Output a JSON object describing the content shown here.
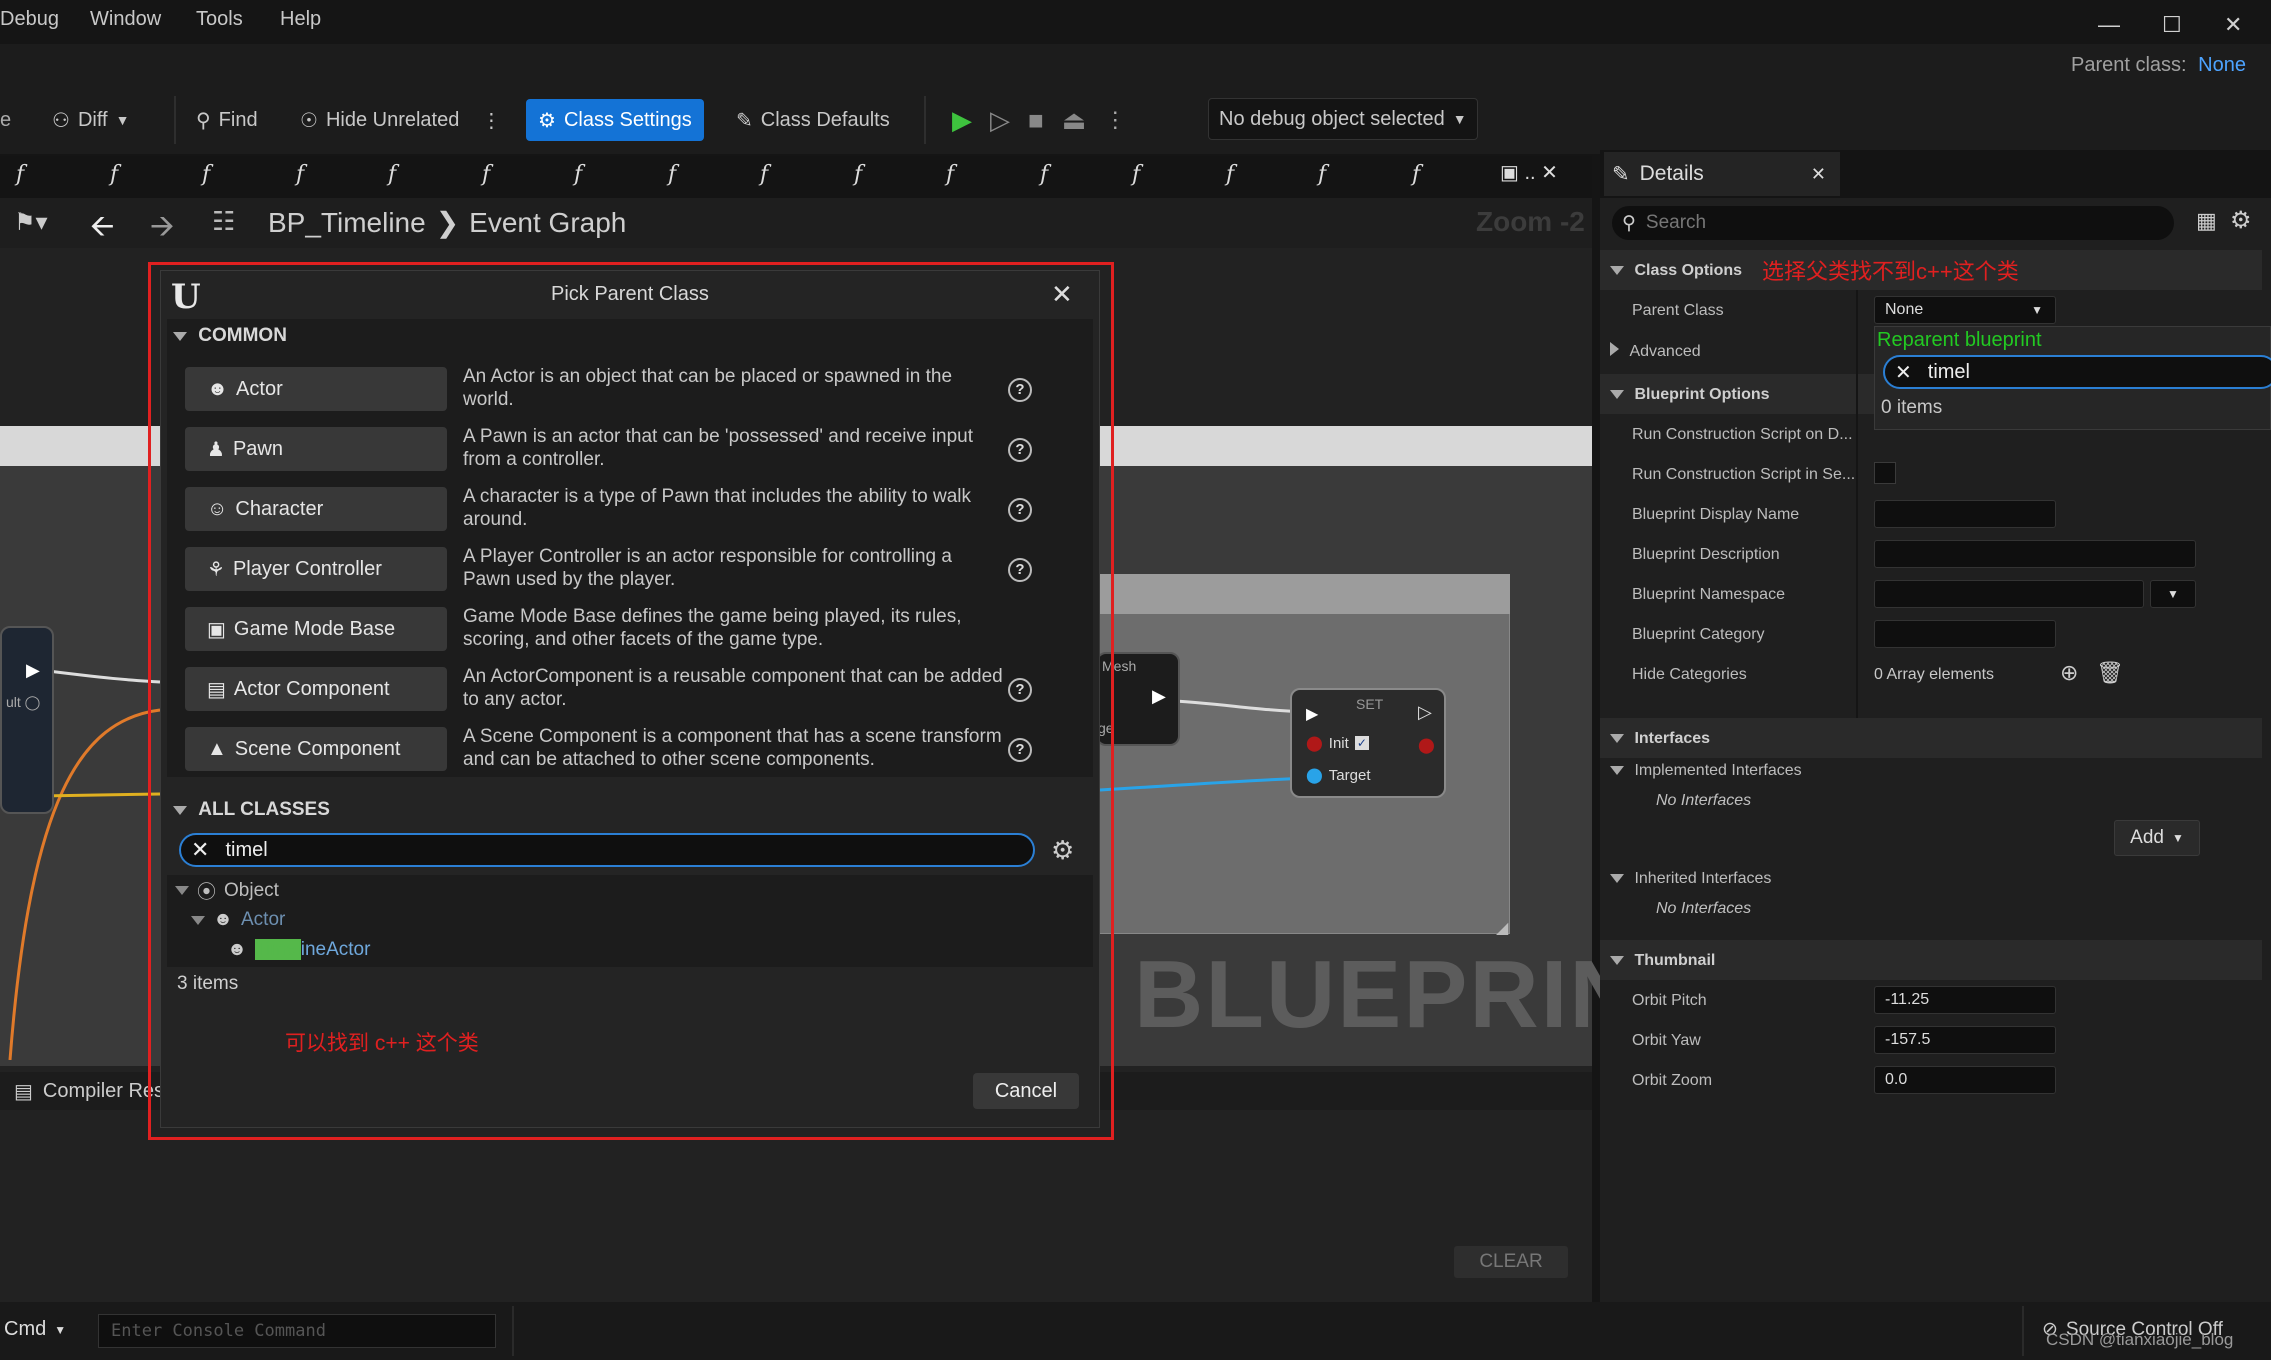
{
  "menu": [
    "Debug",
    "Window",
    "Tools",
    "Help"
  ],
  "parent_class_label": "Parent class:",
  "parent_class_value": "None",
  "toolbar": {
    "diff": "Diff",
    "find": "Find",
    "hide_unrelated": "Hide Unrelated",
    "class_settings": "Class Settings",
    "class_defaults": "Class Defaults",
    "debug_object": "No debug object selected"
  },
  "breadcrumb": {
    "blueprint": "BP_Timeline",
    "graph": "Event Graph",
    "zoom": "Zoom -2"
  },
  "graph": {
    "node_mesh_label": "Mesh",
    "node_set_title": "SET",
    "node_init": "Init",
    "node_target": "Target",
    "watermark": "BLUEPRINT",
    "compiler_results": "Compiler Res",
    "clear": "CLEAR"
  },
  "dialog": {
    "title": "Pick Parent Class",
    "common_header": "COMMON",
    "classes": [
      {
        "name": "Actor",
        "icon": "actor-icon",
        "desc": "An Actor is an object that can be placed or spawned in the world."
      },
      {
        "name": "Pawn",
        "icon": "pawn-icon",
        "desc": "A Pawn is an actor that can be 'possessed' and receive input from a controller."
      },
      {
        "name": "Character",
        "icon": "character-icon",
        "desc": "A character is a type of Pawn that includes the ability to walk around."
      },
      {
        "name": "Player Controller",
        "icon": "controller-icon",
        "desc": "A Player Controller is an actor responsible for controlling a Pawn used by the player."
      },
      {
        "name": "Game Mode Base",
        "icon": "gamemode-icon",
        "desc": "Game Mode Base defines the game being played, its rules, scoring, and other facets of the game type."
      },
      {
        "name": "Actor Component",
        "icon": "component-icon",
        "desc": "An ActorComponent is a reusable component that can be added to any actor."
      },
      {
        "name": "Scene Component",
        "icon": "scene-component-icon",
        "desc": "A Scene Component is a component that has a scene transform and can be attached to other scene components."
      }
    ],
    "all_classes_header": "ALL CLASSES",
    "search_value": "timel",
    "tree": {
      "object": "Object",
      "actor": "Actor",
      "match_highlight": "Timel",
      "match_rest": "ineActor"
    },
    "items_count": "3 items",
    "annotation": "可以找到 c++ 这个类",
    "cancel": "Cancel"
  },
  "details": {
    "tab": "Details",
    "search_placeholder": "Search",
    "annotation": "选择父类找不到c++这个类",
    "class_options": "Class Options",
    "parent_class": "Parent Class",
    "parent_class_value": "None",
    "advanced": "Advanced",
    "reparent_label": "Reparent blueprint",
    "reparent_search": "timel",
    "reparent_count": "0 items",
    "blueprint_options": "Blueprint Options",
    "run_construction_1": "Run Construction Script on D...",
    "run_construction_2": "Run Construction Script in Se...",
    "display_name": "Blueprint Display Name",
    "description": "Blueprint Description",
    "namespace": "Blueprint Namespace",
    "category": "Blueprint Category",
    "hide_categories": "Hide Categories",
    "array_elements": "0 Array elements",
    "interfaces": "Interfaces",
    "implemented": "Implemented Interfaces",
    "no_interfaces": "No Interfaces",
    "add": "Add",
    "inherited": "Inherited Interfaces",
    "thumbnail": "Thumbnail",
    "orbit_pitch": "Orbit Pitch",
    "orbit_pitch_val": "-11.25",
    "orbit_yaw": "Orbit Yaw",
    "orbit_yaw_val": "-157.5",
    "orbit_zoom": "Orbit Zoom",
    "orbit_zoom_val": "0.0"
  },
  "bottom": {
    "cmd": "Cmd",
    "console_placeholder": "Enter Console Command",
    "source_control": "Source Control Off",
    "watermark": "CSDN @tianxiaojie_blog"
  }
}
